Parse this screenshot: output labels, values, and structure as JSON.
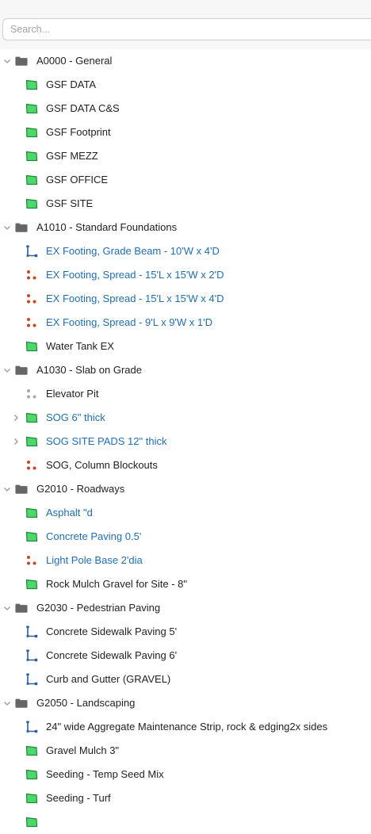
{
  "search": {
    "placeholder": "Search..."
  },
  "colors": {
    "accent_text": "#1e6fb8",
    "area_fill": "#4cd86a",
    "area_stroke": "#1d8a35",
    "linear": "#2a5f9e",
    "count_active": "#c8461a",
    "count_inactive": "#a9a9a9",
    "folder": "#666666"
  },
  "groups": [
    {
      "label": "A0000 - General",
      "expanded": true,
      "items": [
        {
          "label": "GSF DATA",
          "icon": "area-icon",
          "highlight": false,
          "expandable": false
        },
        {
          "label": "GSF DATA C&S",
          "icon": "area-icon",
          "highlight": false,
          "expandable": false
        },
        {
          "label": "GSF Footprint",
          "icon": "area-icon",
          "highlight": false,
          "expandable": false
        },
        {
          "label": "GSF MEZZ",
          "icon": "area-icon",
          "highlight": false,
          "expandable": false
        },
        {
          "label": "GSF OFFICE",
          "icon": "area-icon",
          "highlight": false,
          "expandable": false
        },
        {
          "label": "GSF SITE",
          "icon": "area-icon",
          "highlight": false,
          "expandable": false
        }
      ]
    },
    {
      "label": "A1010 - Standard Foundations",
      "expanded": true,
      "items": [
        {
          "label": "EX Footing, Grade Beam - 10'W x 4'D",
          "icon": "linear-icon",
          "highlight": true,
          "expandable": false
        },
        {
          "label": "EX Footing, Spread - 15'L x 15'W x 2'D",
          "icon": "count-icon",
          "highlight": true,
          "expandable": false
        },
        {
          "label": "EX Footing, Spread - 15'L x 15'W x 4'D",
          "icon": "count-icon",
          "highlight": true,
          "expandable": false
        },
        {
          "label": "EX Footing, Spread - 9'L x 9'W x 1'D",
          "icon": "count-icon",
          "highlight": true,
          "expandable": false
        },
        {
          "label": "Water Tank EX",
          "icon": "area-icon",
          "highlight": false,
          "expandable": false
        }
      ]
    },
    {
      "label": "A1030 - Slab on Grade",
      "expanded": true,
      "items": [
        {
          "label": "Elevator Pit",
          "icon": "count-inactive-icon",
          "highlight": false,
          "expandable": false
        },
        {
          "label": "SOG 6\" thick",
          "icon": "area-icon",
          "highlight": true,
          "expandable": true
        },
        {
          "label": "SOG SITE PADS 12\" thick",
          "icon": "area-icon",
          "highlight": true,
          "expandable": true
        },
        {
          "label": "SOG, Column Blockouts",
          "icon": "count-icon",
          "highlight": false,
          "expandable": false
        }
      ]
    },
    {
      "label": "G2010 - Roadways",
      "expanded": true,
      "items": [
        {
          "label": "Asphalt \"d",
          "icon": "area-icon",
          "highlight": true,
          "expandable": false
        },
        {
          "label": "Concrete Paving 0.5'",
          "icon": "area-icon",
          "highlight": true,
          "expandable": false
        },
        {
          "label": "Light Pole Base 2'dia",
          "icon": "count-icon",
          "highlight": true,
          "expandable": false
        },
        {
          "label": "Rock Mulch Gravel for Site - 8\"",
          "icon": "area-icon",
          "highlight": false,
          "expandable": false
        }
      ]
    },
    {
      "label": "G2030 - Pedestrian Paving",
      "expanded": true,
      "items": [
        {
          "label": "Concrete Sidewalk Paving 5'",
          "icon": "linear-icon",
          "highlight": false,
          "expandable": false
        },
        {
          "label": "Concrete Sidewalk Paving 6'",
          "icon": "linear-icon",
          "highlight": false,
          "expandable": false
        },
        {
          "label": "Curb and Gutter (GRAVEL)",
          "icon": "linear-icon",
          "highlight": false,
          "expandable": false
        }
      ]
    },
    {
      "label": "G2050 - Landscaping",
      "expanded": true,
      "items": [
        {
          "label": "24\" wide Aggregate Maintenance Strip, rock & edging2x sides",
          "icon": "linear-icon",
          "highlight": false,
          "expandable": false
        },
        {
          "label": "Gravel Mulch 3\"",
          "icon": "area-icon",
          "highlight": false,
          "expandable": false
        },
        {
          "label": "Seeding - Temp Seed Mix",
          "icon": "area-icon",
          "highlight": false,
          "expandable": false
        },
        {
          "label": "Seeding - Turf",
          "icon": "area-icon",
          "highlight": false,
          "expandable": false
        },
        {
          "label": "",
          "icon": "area-icon",
          "highlight": false,
          "expandable": false
        }
      ]
    }
  ]
}
